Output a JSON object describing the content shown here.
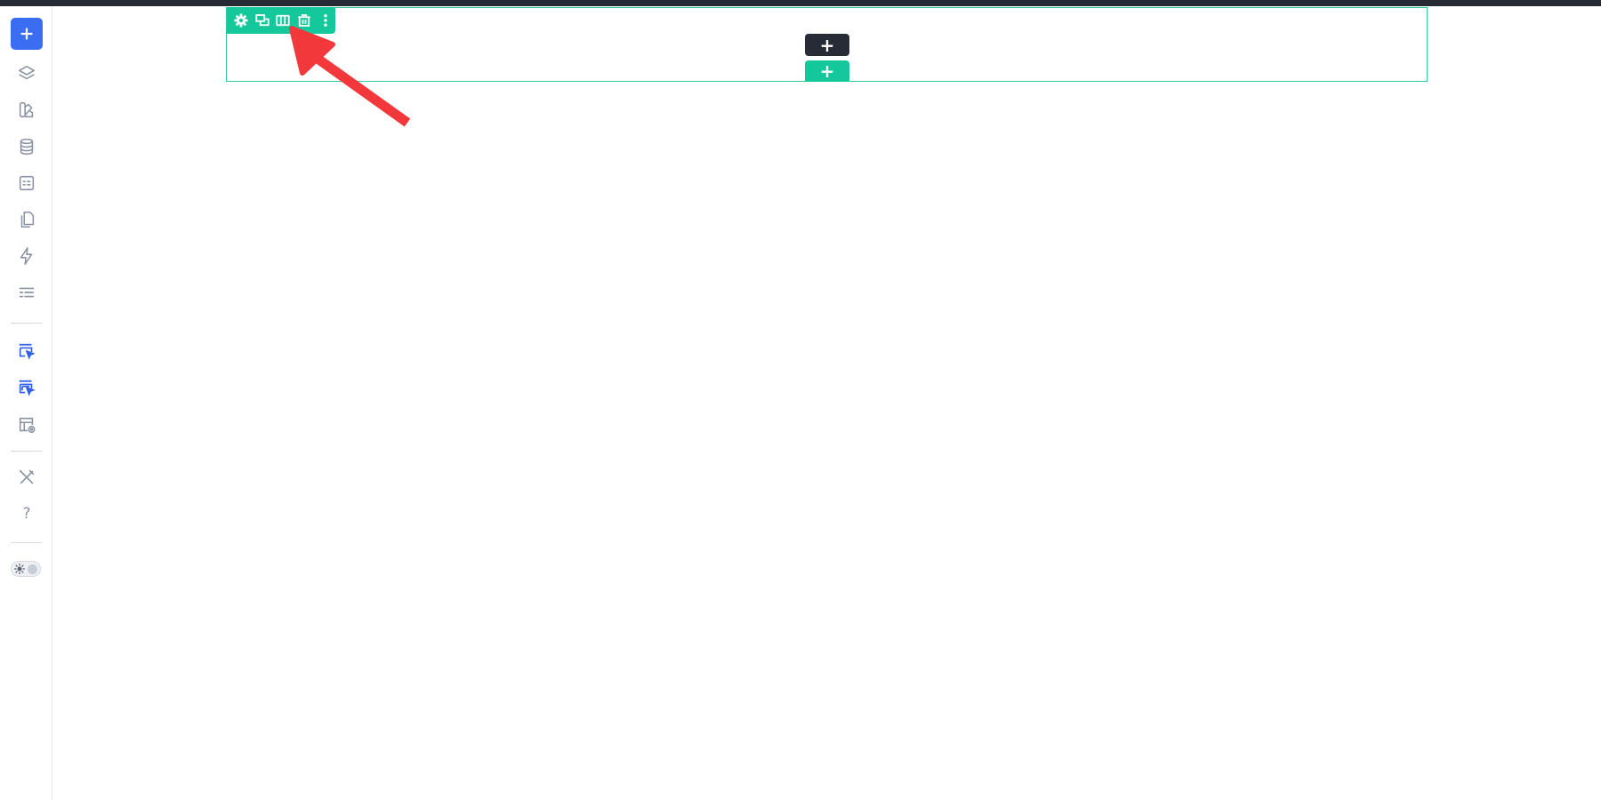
{
  "colors": {
    "topbar": "#262b36",
    "accent_blue": "#3b6df2",
    "section_green": "#14c89b",
    "icon_gray": "#8b92a3",
    "icon_blue": "#2f5ee8",
    "annotation_red": "#f2383a"
  },
  "sidebar": {
    "items": [
      {
        "name": "add-icon",
        "active": true
      },
      {
        "name": "layers-icon"
      },
      {
        "name": "global-styles-icon"
      },
      {
        "name": "database-icon"
      },
      {
        "name": "forms-icon"
      },
      {
        "name": "pages-icon"
      },
      {
        "name": "automation-icon"
      },
      {
        "name": "settings-list-icon"
      },
      {
        "name": "select-element-icon",
        "highlighted": true
      },
      {
        "name": "select-parent-icon",
        "highlighted": true
      },
      {
        "name": "preview-layout-icon"
      },
      {
        "name": "tools-icon"
      },
      {
        "name": "help-icon"
      }
    ],
    "help_label": "?",
    "theme_toggle": {
      "state": "light"
    }
  },
  "section_toolbar": {
    "buttons": [
      "settings-icon",
      "duplicate-icon",
      "columns-icon",
      "delete-icon",
      "more-icon"
    ]
  },
  "canvas": {
    "add_element_label": "+",
    "add_section_label": "+"
  }
}
